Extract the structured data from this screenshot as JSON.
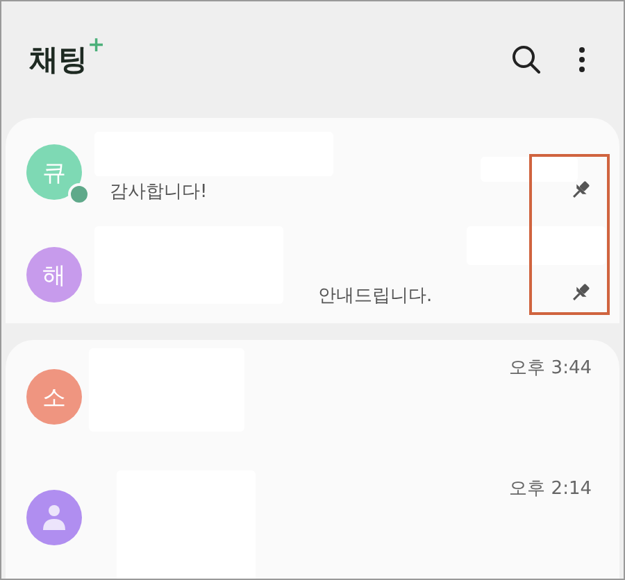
{
  "header": {
    "title": "채팅",
    "title_mark": "+"
  },
  "pinned_chats": [
    {
      "avatar": "큐",
      "kind": "letter",
      "color": "#7ed9b4",
      "unread_dot": true,
      "message": "감사합니다!",
      "pinned": true
    },
    {
      "avatar": "해",
      "kind": "letter",
      "color": "#c79bec",
      "unread_dot": false,
      "message": "안내드립니다.",
      "pinned": true
    }
  ],
  "chats": [
    {
      "avatar": "소",
      "kind": "letter",
      "color": "#ef9580",
      "unread_dot": false,
      "time": "오후 3:44",
      "pinned": false
    },
    {
      "kind": "person",
      "color": "#b08ef0",
      "unread_dot": false,
      "time": "오후 2:14",
      "pinned": false
    }
  ]
}
